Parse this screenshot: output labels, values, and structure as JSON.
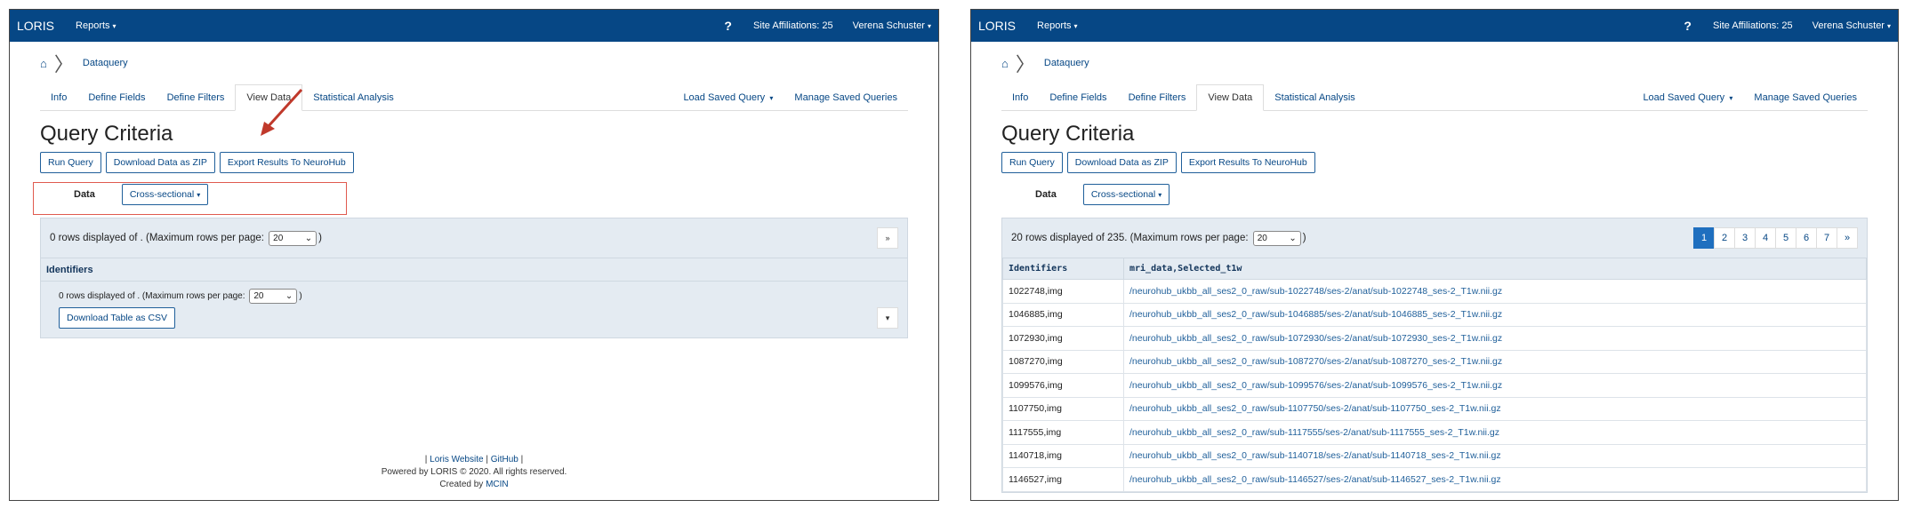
{
  "navbar": {
    "brand": "LORIS",
    "reports": "Reports",
    "help": "?",
    "affiliations": "Site Affiliations: 25",
    "user": "Verena Schuster"
  },
  "breadcrumb": {
    "page": "Dataquery"
  },
  "tabs": [
    "Info",
    "Define Fields",
    "Define Filters",
    "View Data",
    "Statistical Analysis"
  ],
  "tab_actions": {
    "load_saved": "Load Saved Query",
    "manage_saved": "Manage Saved Queries"
  },
  "title": "Query Criteria",
  "buttons": {
    "run_query": "Run Query",
    "download_zip": "Download Data as ZIP",
    "export_neurohub": "Export Results To NeuroHub"
  },
  "data_row": {
    "label": "Data",
    "mode": "Cross-sectional"
  },
  "left": {
    "rows_text_before": "0 rows displayed of . (Maximum rows per page:",
    "rows_text_after": ")",
    "rows_per_page": "20",
    "next_label": "»",
    "identifiers_header": "Identifiers",
    "inner_rows_text": "0 rows displayed of . (Maximum rows per page:",
    "inner_rows_after": ")",
    "inner_rows_per_page": "20",
    "download_csv": "Download Table as CSV",
    "inner_button": "▾"
  },
  "footer": {
    "sep": "|",
    "website": "Loris Website",
    "github": "GitHub",
    "powered": "Powered by LORIS © 2020. All rights reserved.",
    "created_prefix": "Created by",
    "created_link": "MCIN"
  },
  "right": {
    "rows_text_before": "20 rows displayed of 235. (Maximum rows per page:",
    "rows_text_after": ")",
    "rows_per_page": "20",
    "pages": [
      "1",
      "2",
      "3",
      "4",
      "5",
      "6",
      "7",
      "»"
    ],
    "columns": [
      "Identifiers",
      "mri_data,Selected_t1w"
    ],
    "rows": [
      [
        "1022748,img",
        "/neurohub_ukbb_all_ses2_0_raw/sub-1022748/ses-2/anat/sub-1022748_ses-2_T1w.nii.gz"
      ],
      [
        "1046885,img",
        "/neurohub_ukbb_all_ses2_0_raw/sub-1046885/ses-2/anat/sub-1046885_ses-2_T1w.nii.gz"
      ],
      [
        "1072930,img",
        "/neurohub_ukbb_all_ses2_0_raw/sub-1072930/ses-2/anat/sub-1072930_ses-2_T1w.nii.gz"
      ],
      [
        "1087270,img",
        "/neurohub_ukbb_all_ses2_0_raw/sub-1087270/ses-2/anat/sub-1087270_ses-2_T1w.nii.gz"
      ],
      [
        "1099576,img",
        "/neurohub_ukbb_all_ses2_0_raw/sub-1099576/ses-2/anat/sub-1099576_ses-2_T1w.nii.gz"
      ],
      [
        "1107750,img",
        "/neurohub_ukbb_all_ses2_0_raw/sub-1107750/ses-2/anat/sub-1107750_ses-2_T1w.nii.gz"
      ],
      [
        "1117555,img",
        "/neurohub_ukbb_all_ses2_0_raw/sub-1117555/ses-2/anat/sub-1117555_ses-2_T1w.nii.gz"
      ],
      [
        "1140718,img",
        "/neurohub_ukbb_all_ses2_0_raw/sub-1140718/ses-2/anat/sub-1140718_ses-2_T1w.nii.gz"
      ],
      [
        "1146527,img",
        "/neurohub_ukbb_all_ses2_0_raw/sub-1146527/ses-2/anat/sub-1146527_ses-2_T1w.nii.gz"
      ]
    ]
  },
  "colors": {
    "navbar": "#064785",
    "link": "#1f5f9a",
    "highlight": "#e05a4f",
    "panel_bg": "#e4ebf2"
  },
  "icons": {
    "home": "home-icon",
    "arrow": "pointer-arrow-icon"
  }
}
